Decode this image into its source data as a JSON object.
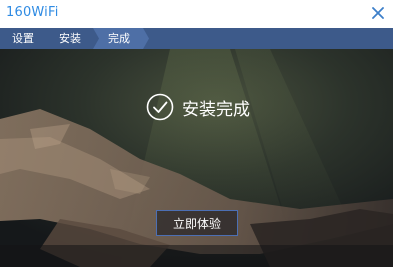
{
  "window": {
    "title": "160WiFi"
  },
  "steps": [
    {
      "label": "设置"
    },
    {
      "label": "安装"
    },
    {
      "label": "完成"
    }
  ],
  "status": {
    "message": "安装完成"
  },
  "actions": {
    "try_now_label": "立即体验"
  },
  "icons": {
    "close": "close-icon",
    "status": "check-circle-icon"
  },
  "colors": {
    "title_text": "#2f8be3",
    "stepbar": "#3d5a8a",
    "step_active": "#4e6fa6",
    "button_border": "#4c6fb4"
  }
}
